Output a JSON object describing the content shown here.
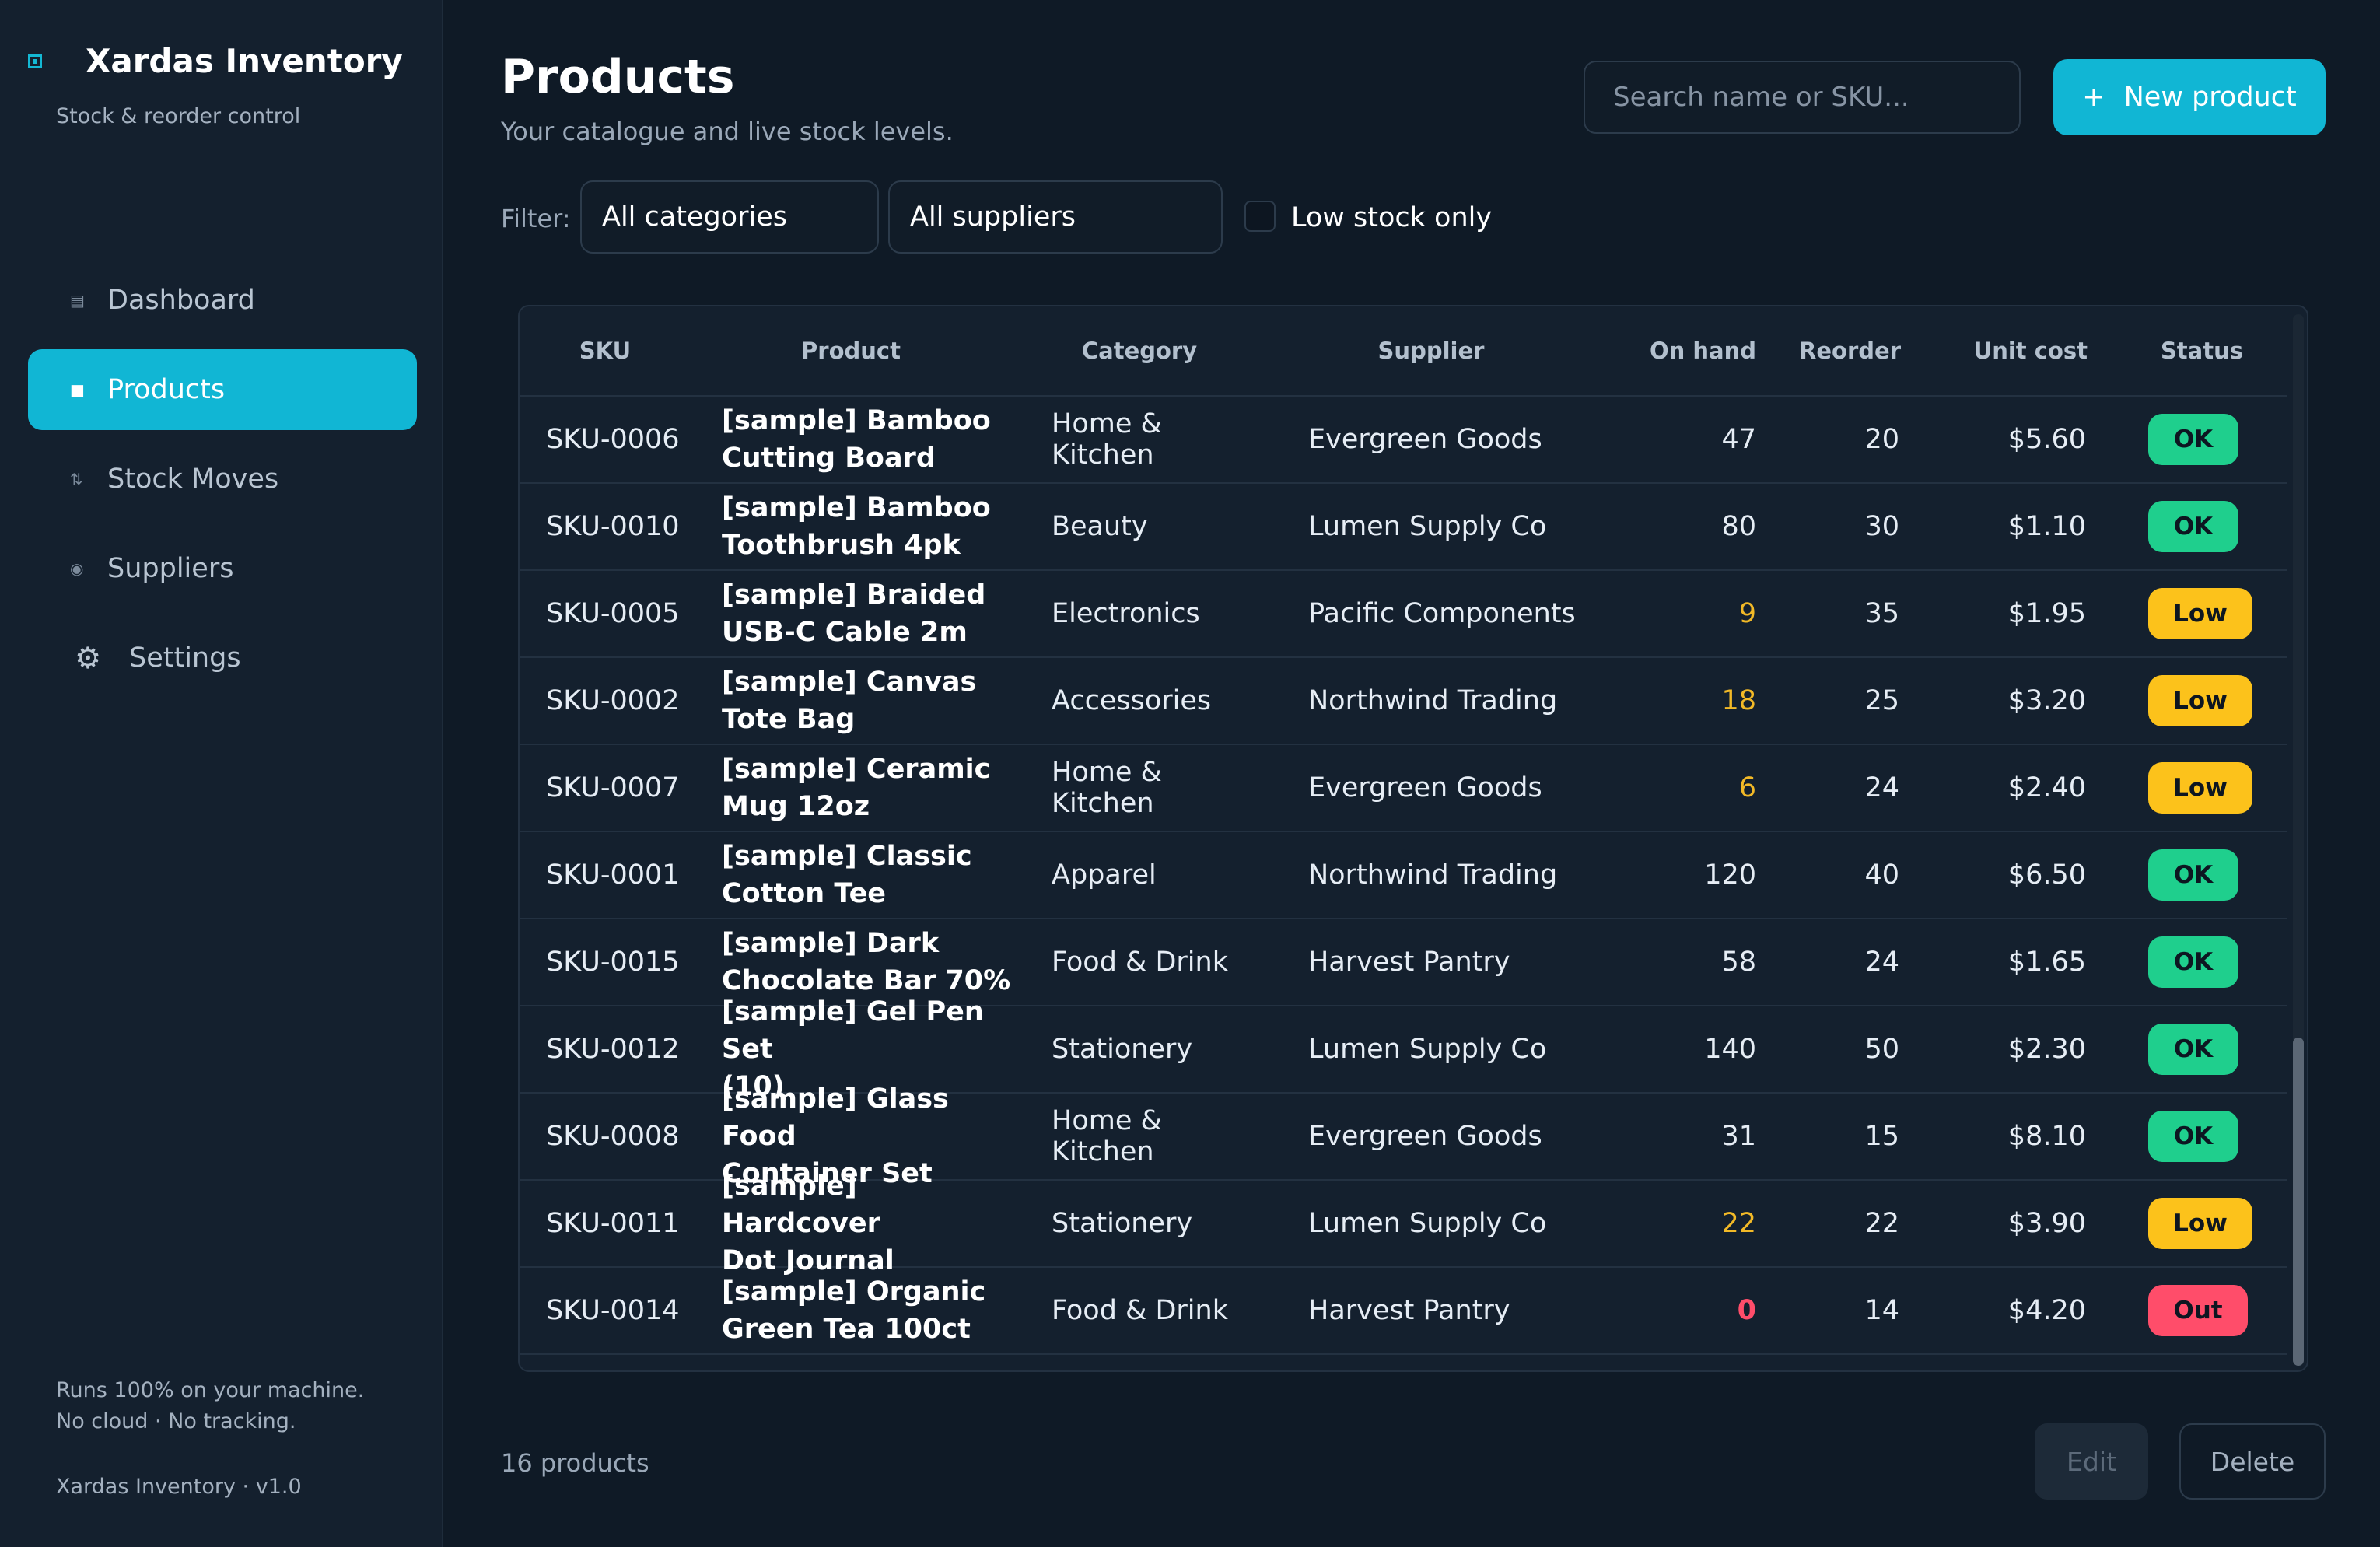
{
  "sidebar": {
    "app_title": "Xardas Inventory",
    "app_subtitle": "Stock & reorder control",
    "items": [
      {
        "label": "Dashboard",
        "icon": "dashboard-icon"
      },
      {
        "label": "Products",
        "icon": "products-icon"
      },
      {
        "label": "Stock Moves",
        "icon": "stock-moves-icon"
      },
      {
        "label": "Suppliers",
        "icon": "suppliers-icon"
      },
      {
        "label": "Settings",
        "icon": "gear-icon"
      }
    ],
    "footer_line1": "Runs 100% on your machine.",
    "footer_line2": "No cloud · No tracking.",
    "version": "Xardas Inventory · v1.0"
  },
  "header": {
    "title": "Products",
    "subtitle": "Your catalogue and live stock levels.",
    "search_placeholder": "Search name or SKU...",
    "new_button": "New product",
    "new_button_icon": "+"
  },
  "filters": {
    "label": "Filter:",
    "category": "All categories",
    "supplier": "All suppliers",
    "low_stock_label": "Low stock only",
    "low_stock_checked": false
  },
  "table": {
    "columns": [
      "SKU",
      "Product",
      "Category",
      "Supplier",
      "On hand",
      "Reorder",
      "Unit cost",
      "Status"
    ],
    "rows": [
      {
        "sku": "SKU-0006",
        "product_line1": "[sample] Bamboo",
        "product_line2": "Cutting Board",
        "category": "Home & Kitchen",
        "supplier": "Evergreen Goods",
        "on_hand": "47",
        "reorder": "20",
        "unit_cost": "$5.60",
        "status": "OK"
      },
      {
        "sku": "SKU-0010",
        "product_line1": "[sample] Bamboo",
        "product_line2": "Toothbrush 4pk",
        "category": "Beauty",
        "supplier": "Lumen Supply Co",
        "on_hand": "80",
        "reorder": "30",
        "unit_cost": "$1.10",
        "status": "OK"
      },
      {
        "sku": "SKU-0005",
        "product_line1": "[sample] Braided",
        "product_line2": "USB-C Cable 2m",
        "category": "Electronics",
        "supplier": "Pacific Components",
        "on_hand": "9",
        "reorder": "35",
        "unit_cost": "$1.95",
        "status": "Low"
      },
      {
        "sku": "SKU-0002",
        "product_line1": "[sample] Canvas",
        "product_line2": "Tote Bag",
        "category": "Accessories",
        "supplier": "Northwind Trading",
        "on_hand": "18",
        "reorder": "25",
        "unit_cost": "$3.20",
        "status": "Low"
      },
      {
        "sku": "SKU-0007",
        "product_line1": "[sample] Ceramic",
        "product_line2": "Mug 12oz",
        "category": "Home & Kitchen",
        "supplier": "Evergreen Goods",
        "on_hand": "6",
        "reorder": "24",
        "unit_cost": "$2.40",
        "status": "Low"
      },
      {
        "sku": "SKU-0001",
        "product_line1": "[sample] Classic",
        "product_line2": "Cotton Tee",
        "category": "Apparel",
        "supplier": "Northwind Trading",
        "on_hand": "120",
        "reorder": "40",
        "unit_cost": "$6.50",
        "status": "OK"
      },
      {
        "sku": "SKU-0015",
        "product_line1": "[sample] Dark",
        "product_line2": "Chocolate Bar 70%",
        "category": "Food & Drink",
        "supplier": "Harvest Pantry",
        "on_hand": "58",
        "reorder": "24",
        "unit_cost": "$1.65",
        "status": "OK"
      },
      {
        "sku": "SKU-0012",
        "product_line1": "[sample] Gel Pen Set",
        "product_line2": "(10)",
        "category": "Stationery",
        "supplier": "Lumen Supply Co",
        "on_hand": "140",
        "reorder": "50",
        "unit_cost": "$2.30",
        "status": "OK"
      },
      {
        "sku": "SKU-0008",
        "product_line1": "[sample] Glass Food",
        "product_line2": "Container Set",
        "category": "Home & Kitchen",
        "supplier": "Evergreen Goods",
        "on_hand": "31",
        "reorder": "15",
        "unit_cost": "$8.10",
        "status": "OK"
      },
      {
        "sku": "SKU-0011",
        "product_line1": "[sample] Hardcover",
        "product_line2": "Dot Journal",
        "category": "Stationery",
        "supplier": "Lumen Supply Co",
        "on_hand": "22",
        "reorder": "22",
        "unit_cost": "$3.90",
        "status": "Low"
      },
      {
        "sku": "SKU-0014",
        "product_line1": "[sample] Organic",
        "product_line2": "Green Tea 100ct",
        "category": "Food & Drink",
        "supplier": "Harvest Pantry",
        "on_hand": "0",
        "reorder": "14",
        "unit_cost": "$4.20",
        "status": "Out"
      }
    ]
  },
  "footer": {
    "count": "16 products",
    "edit_button": "Edit",
    "delete_button": "Delete"
  },
  "colors": {
    "accent": "#11b6d4",
    "ok": "#1fcf8d",
    "low": "#fcc21b",
    "out": "#ff4d6a",
    "background": "#0f1a26"
  }
}
